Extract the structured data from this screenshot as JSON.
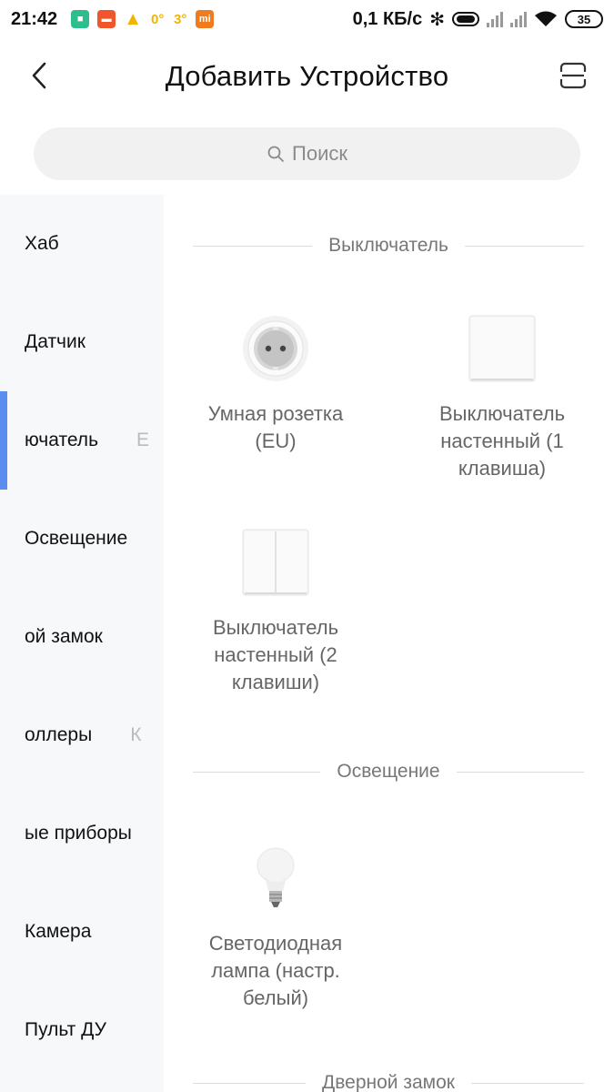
{
  "status_bar": {
    "time": "21:42",
    "temp": "0°",
    "temp2": "3°",
    "net_speed": "0,1 КБ/с",
    "battery": "35"
  },
  "header": {
    "title": "Добавить Устройство"
  },
  "search": {
    "placeholder": "Поиск"
  },
  "sidebar": {
    "items": [
      {
        "label": "Хаб",
        "ghost": ""
      },
      {
        "label": "Датчик",
        "ghost": ""
      },
      {
        "label": "ючатель",
        "ghost": "E"
      },
      {
        "label": "Освещение",
        "ghost": ""
      },
      {
        "label": "ой замок",
        "ghost": ""
      },
      {
        "label": "оллеры",
        "ghost": "К"
      },
      {
        "label": "ые приборы",
        "ghost": ""
      },
      {
        "label": "Камера",
        "ghost": ""
      },
      {
        "label": "Пульт ДУ",
        "ghost": ""
      }
    ],
    "active_index": 2,
    "accent": "#5b8def"
  },
  "sections": [
    {
      "title": "Выключатель",
      "devices": [
        {
          "label": "Умная розетка (EU)",
          "icon": "socket-icon"
        },
        {
          "label": "Выключатель настенный (1 клавиша)",
          "icon": "switch-1-icon"
        },
        {
          "label": "Выключатель настенный (2 клавиши)",
          "icon": "switch-2-icon"
        }
      ]
    },
    {
      "title": "Освещение",
      "devices": [
        {
          "label": "Светодиодная лампа (настр. белый)",
          "icon": "bulb-icon"
        }
      ]
    },
    {
      "title": "Дверной замок",
      "devices": []
    }
  ]
}
